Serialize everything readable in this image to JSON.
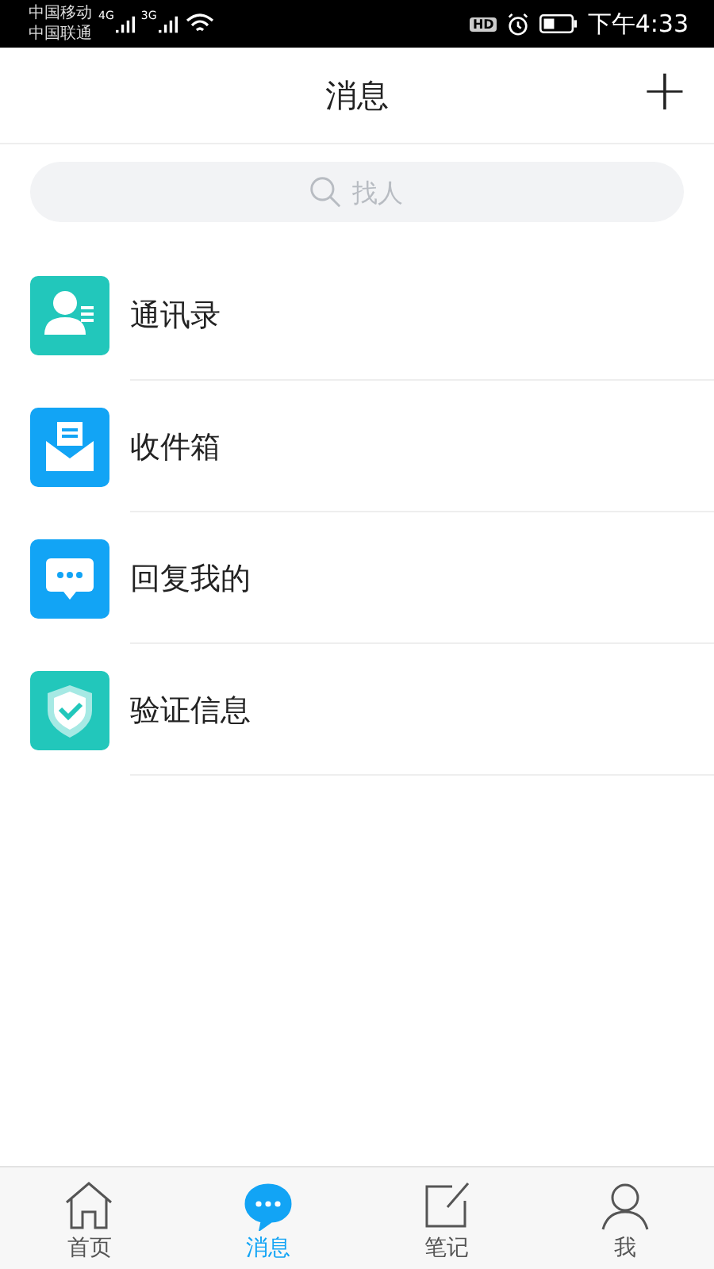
{
  "status_bar": {
    "carriers": [
      "中国移动",
      "中国联通"
    ],
    "networks": [
      "4G",
      "3G"
    ],
    "time": "下午4:33",
    "hd": "HD"
  },
  "header": {
    "title": "消息",
    "add_icon": "+"
  },
  "search": {
    "placeholder": "找人"
  },
  "items": [
    {
      "label": "通讯录",
      "kind": "contacts",
      "color": "#22c7bb"
    },
    {
      "label": "收件箱",
      "kind": "inbox",
      "color": "#12a4f5"
    },
    {
      "label": "回复我的",
      "kind": "reply",
      "color": "#12a4f5"
    },
    {
      "label": "验证信息",
      "kind": "verify",
      "color": "#22c7bb"
    }
  ],
  "tabs": [
    {
      "label": "首页",
      "kind": "home",
      "selected": false
    },
    {
      "label": "消息",
      "kind": "message",
      "selected": true
    },
    {
      "label": "笔记",
      "kind": "note",
      "selected": false
    },
    {
      "label": "我",
      "kind": "me",
      "selected": false
    }
  ]
}
